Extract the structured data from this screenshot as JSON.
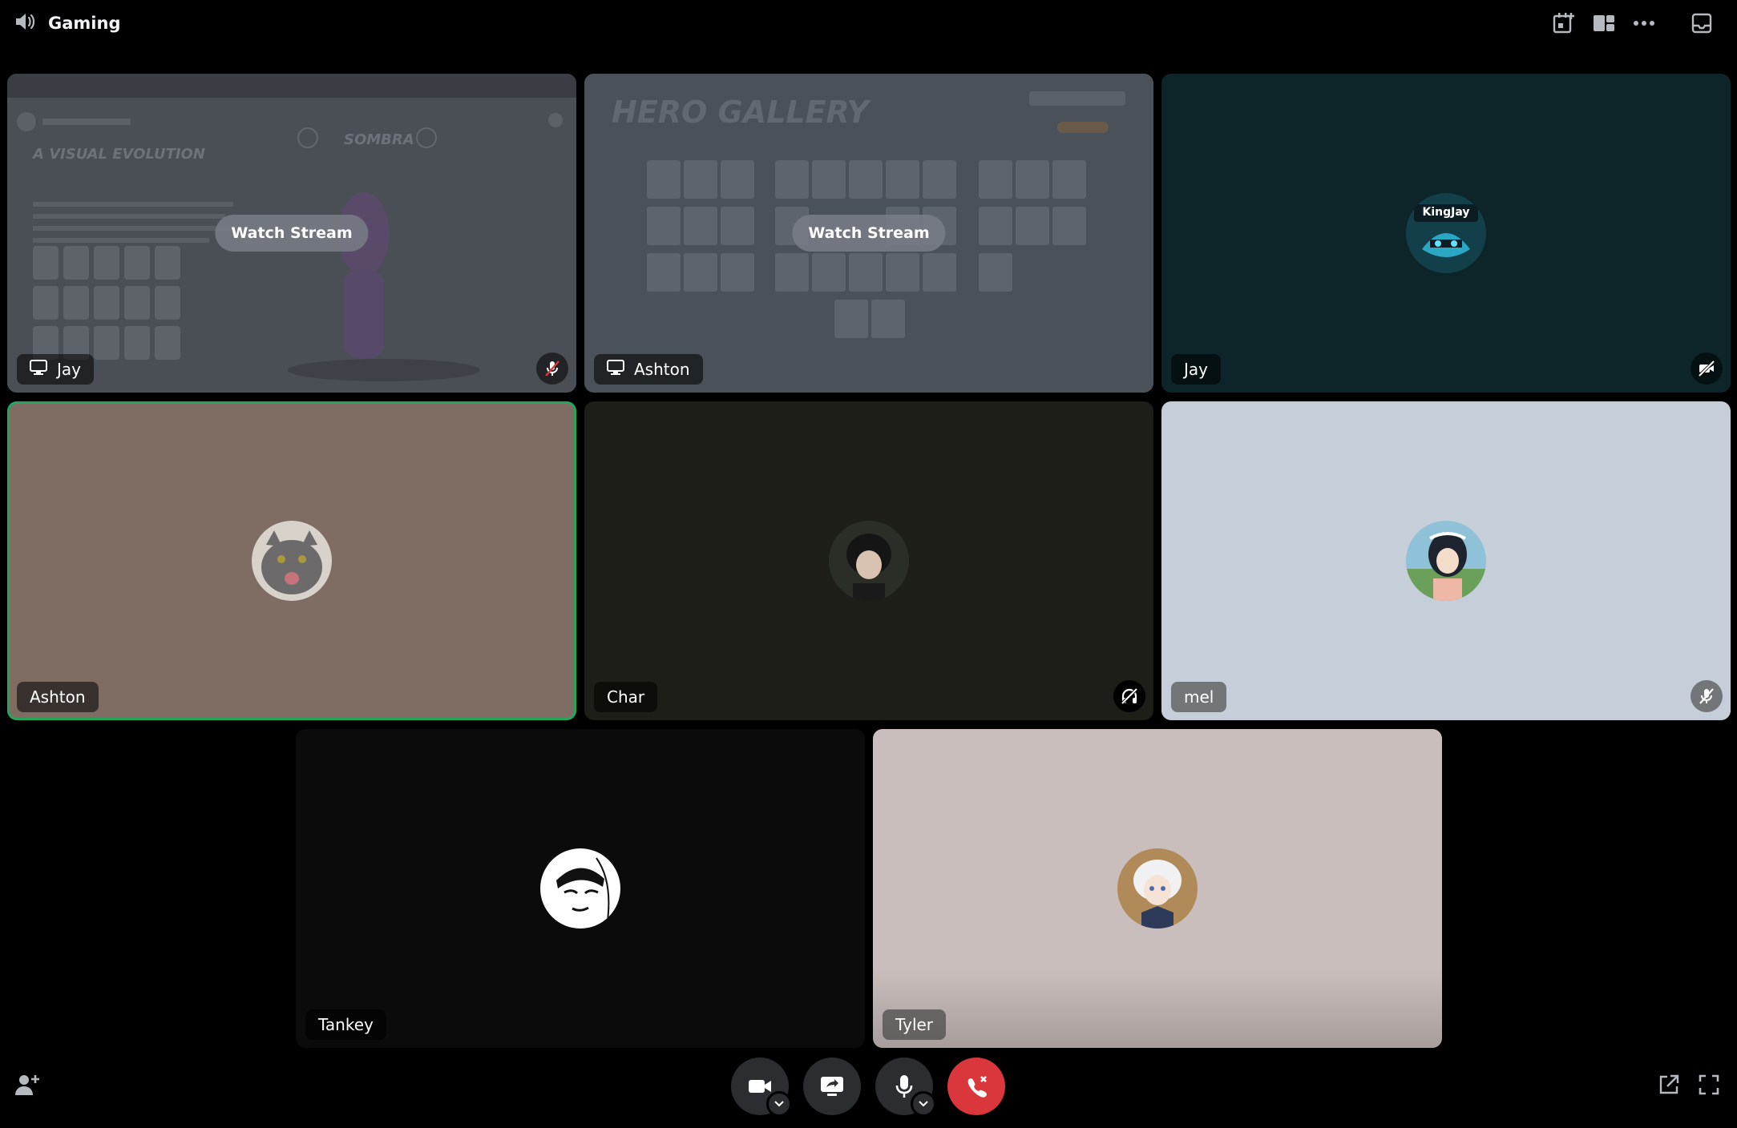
{
  "header": {
    "channel_name": "Gaming",
    "icons": [
      "speaker-icon",
      "add-activity-icon",
      "layout-grid-icon",
      "more-options-icon",
      "inbox-icon"
    ]
  },
  "tiles": [
    {
      "name": "Jay",
      "kind": "stream",
      "watch_label": "Watch Stream",
      "status": "muted",
      "stream_title": "A VISUAL EVOLUTION",
      "stream_hero": "SOMBRA"
    },
    {
      "name": "Ashton",
      "kind": "stream",
      "watch_label": "Watch Stream",
      "stream_title": "HERO GALLERY"
    },
    {
      "name": "Jay",
      "kind": "user",
      "status": "camera-off",
      "avatar_text": "KingJay",
      "bg": "#0d2429"
    },
    {
      "name": "Ashton",
      "kind": "user",
      "speaking": true,
      "bg": "#7f6d64"
    },
    {
      "name": "Char",
      "kind": "user",
      "status": "deafened",
      "bg": "#1d1e17"
    },
    {
      "name": "mel",
      "kind": "user",
      "status": "muted",
      "bg": "#c6cfd9"
    },
    {
      "name": "Tankey",
      "kind": "user",
      "bg": "#0b0b0b"
    },
    {
      "name": "Tyler",
      "kind": "user",
      "bg": "#c9bebb"
    }
  ],
  "controls": {
    "items": [
      "camera-icon",
      "screen-share-icon",
      "microphone-icon",
      "leave-call-icon"
    ]
  },
  "colors": {
    "speaking_ring": "#23a55a",
    "leave_red": "#da373c",
    "control_gray": "#2b2d31"
  }
}
